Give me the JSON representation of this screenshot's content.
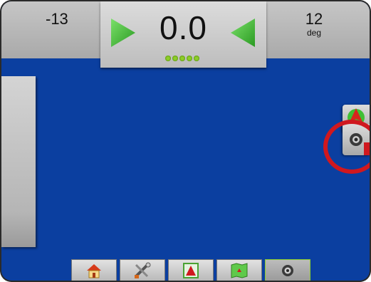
{
  "top_bar": {
    "left_value": "-13",
    "right_value": "12",
    "right_unit": "deg"
  },
  "lightbar": {
    "cross_track": "0.0",
    "led_count": 5,
    "accent_color": "#4cc23a"
  },
  "map": {
    "background_color": "#0b3fa0"
  },
  "right_controls": {
    "orientation_icon": "orientation-arrow-icon",
    "camera_icon": "camera-icon",
    "highlight_color": "#d0181f"
  },
  "bottom_tabs": [
    {
      "icon": "home-icon",
      "active": false
    },
    {
      "icon": "tools-icon",
      "active": false
    },
    {
      "icon": "field-icon",
      "active": false
    },
    {
      "icon": "map-icon",
      "active": false
    },
    {
      "icon": "camera-icon",
      "active": true
    }
  ]
}
